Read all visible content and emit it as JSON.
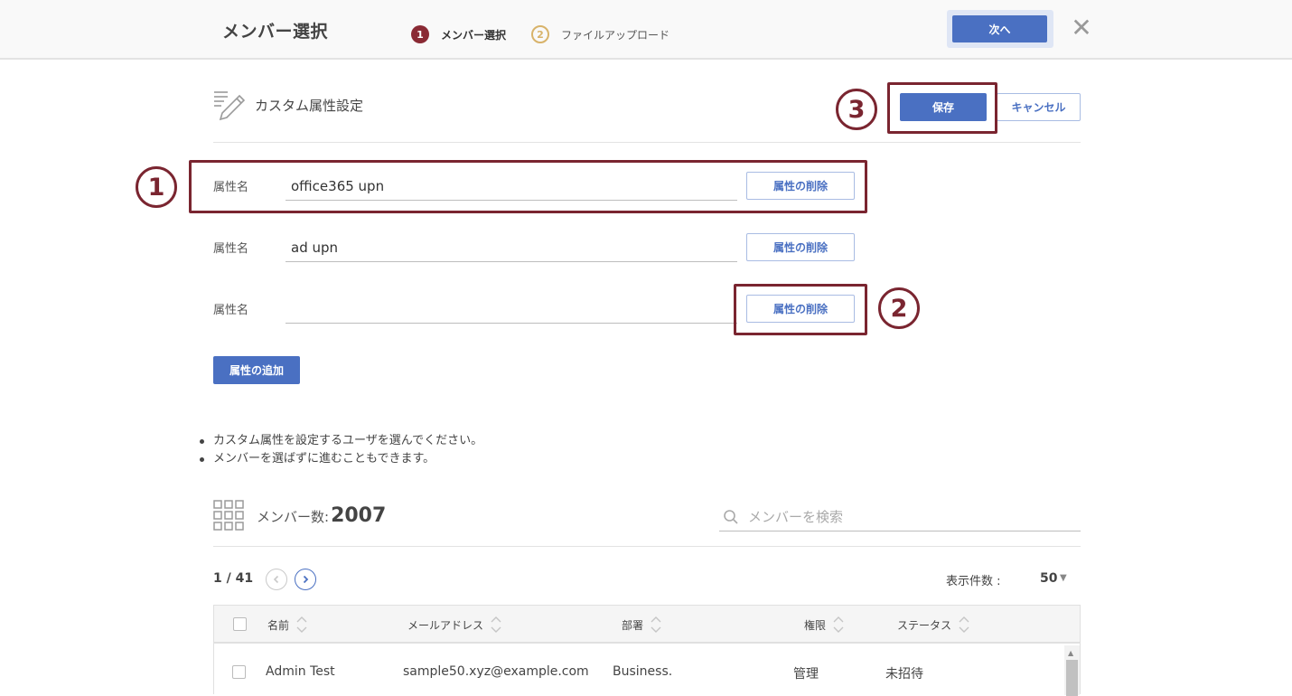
{
  "header": {
    "title": "メンバー選択",
    "steps": [
      {
        "num": "1",
        "label": "メンバー選択"
      },
      {
        "num": "2",
        "label": "ファイルアップロード"
      }
    ],
    "next_label": "次へ",
    "close_glyph": "✕"
  },
  "custom_attr": {
    "title": "カスタム属性設定",
    "save_label": "保存",
    "cancel_label": "キャンセル",
    "rows": [
      {
        "label": "属性名",
        "value": "office365 upn",
        "delete_label": "属性の削除"
      },
      {
        "label": "属性名",
        "value": "ad upn",
        "delete_label": "属性の削除"
      },
      {
        "label": "属性名",
        "value": "",
        "delete_label": "属性の削除"
      }
    ],
    "add_label": "属性の追加"
  },
  "annotations": [
    "1",
    "2",
    "3"
  ],
  "notes": [
    "カスタム属性を設定するユーザを選んでください。",
    "メンバーを選ばずに進むこともできます。"
  ],
  "members": {
    "count_label": "メンバー数:",
    "count": "2007",
    "search_placeholder": "メンバーを検索",
    "page": "1 / 41",
    "per_page_label": "表示件数 :",
    "per_page_value": "50",
    "columns": [
      "名前",
      "メールアドレス",
      "部署",
      "権限",
      "ステータス"
    ],
    "rows": [
      {
        "name": "Admin Test",
        "email": "sample50.xyz@example.com",
        "dept": "Business.",
        "role": "管理",
        "status": "未招待"
      }
    ]
  },
  "colors": {
    "primary": "#4a70c2",
    "annotation": "#7a2530",
    "step_active": "#8a2a34",
    "step_inactive": "#d8b36a"
  }
}
